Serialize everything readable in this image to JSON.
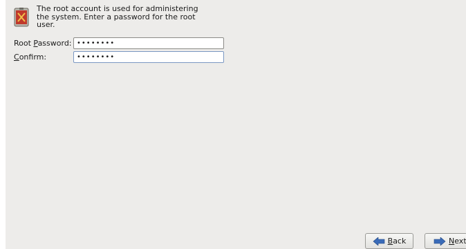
{
  "header": {
    "description": "The root account is used for administering the system.  Enter a password for the root user."
  },
  "form": {
    "root_password_label_prefix": "Root ",
    "root_password_label_mnemonic": "P",
    "root_password_label_suffix": "assword:",
    "root_password_value": "••••••••",
    "confirm_label_mnemonic": "C",
    "confirm_label_suffix": "onfirm:",
    "confirm_value": "••••••••"
  },
  "buttons": {
    "back_mnemonic": "B",
    "back_suffix": "ack",
    "next_mnemonic": "N",
    "next_suffix": "ext"
  },
  "icons": {
    "header_icon": "shield-icon",
    "back_icon": "arrow-left-icon",
    "next_icon": "arrow-right-icon"
  },
  "colors": {
    "panel_bg": "#edecea",
    "arrow_blue": "#3a6bb8",
    "shield_red": "#c0392b"
  }
}
